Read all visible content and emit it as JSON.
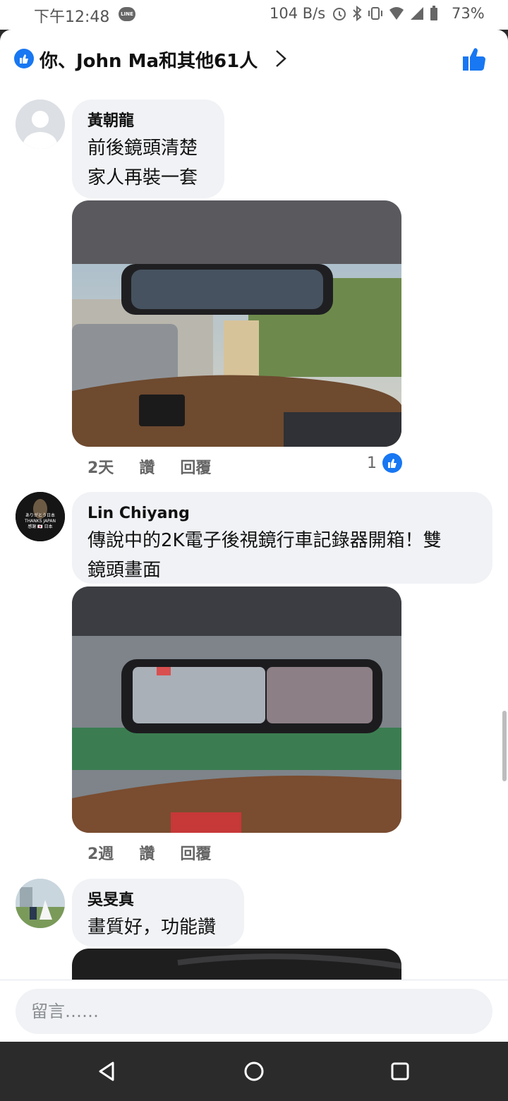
{
  "status_bar": {
    "time": "下午12:48",
    "line_badge": "LINE",
    "net_speed": "104 B/s",
    "battery": "73%"
  },
  "reactions_header": {
    "text": "你、John Ma和其他61人"
  },
  "comments": [
    {
      "name": "黃朝龍",
      "lines": [
        "前後鏡頭清楚",
        "家人再裝一套"
      ],
      "time": "2天",
      "like_label": "讚",
      "reply_label": "回覆",
      "like_count": "1"
    },
    {
      "name": "Lin Chiyang",
      "avatar_line1": "ありがとう日本",
      "avatar_line2": "THANKS JAPAN",
      "avatar_line3": "感謝 🇯🇵 日本",
      "lines": [
        "傳說中的2K電子後視鏡行車記錄器開箱！雙",
        "鏡頭畫面"
      ],
      "time": "2週",
      "like_label": "讚",
      "reply_label": "回覆"
    },
    {
      "name": "吳旻真",
      "lines": [
        "畫質好，功能讚"
      ]
    }
  ],
  "composer": {
    "placeholder": "留言……"
  },
  "colors": {
    "facebook_blue": "#1877f2",
    "bubble_bg": "#f0f2f5"
  }
}
